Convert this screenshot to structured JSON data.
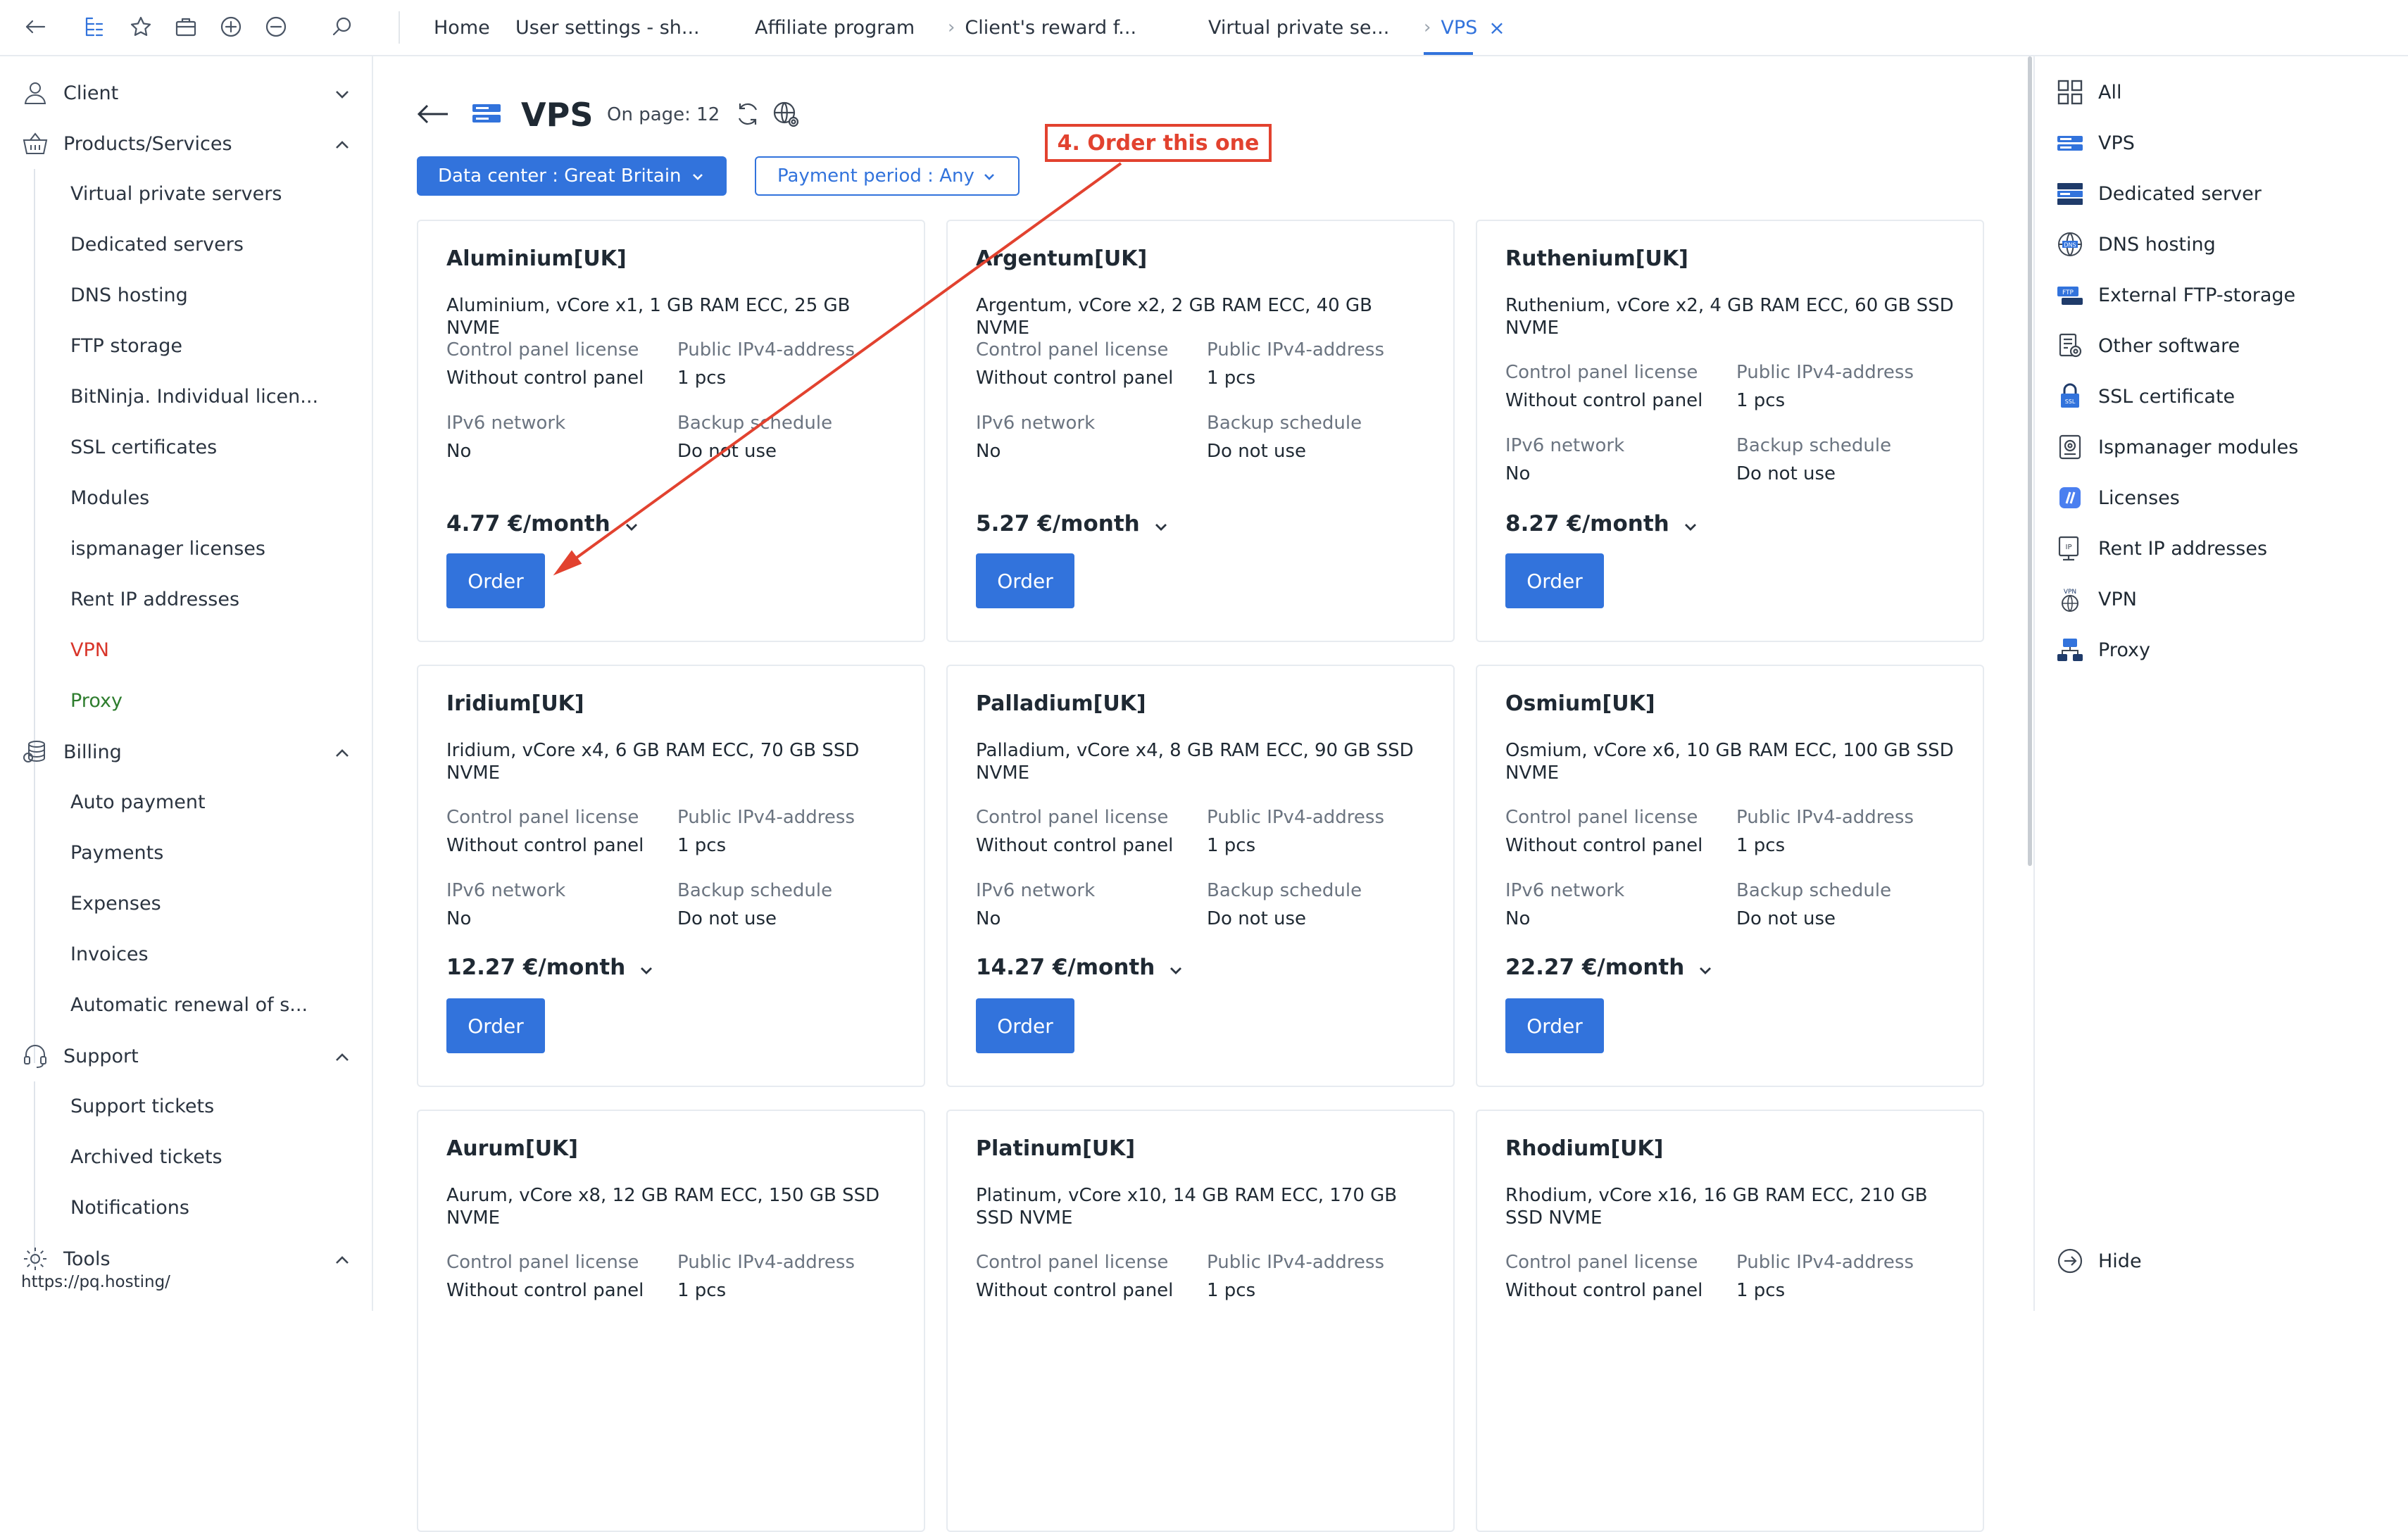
{
  "topbar": {
    "tabs": [
      {
        "label": "Home"
      },
      {
        "label": "User settings - sh..."
      },
      {
        "label": "Affiliate program"
      },
      {
        "label": "Client's reward f..."
      },
      {
        "label": "Virtual private se..."
      },
      {
        "label": "VPS"
      }
    ],
    "close_glyph": "×"
  },
  "sidebar": {
    "sections": [
      {
        "label": "Client",
        "icon": "user-icon"
      },
      {
        "label": "Products/Services",
        "icon": "basket-icon"
      },
      {
        "label": "Billing",
        "icon": "coins-icon"
      },
      {
        "label": "Support",
        "icon": "headset-icon"
      },
      {
        "label": "Tools",
        "icon": "gear-icon"
      }
    ],
    "products": [
      "Virtual private servers",
      "Dedicated servers",
      "DNS hosting",
      "FTP storage",
      "BitNinja. Individual licen...",
      "SSL certificates",
      "Modules",
      "ispmanager licenses",
      "Rent IP addresses",
      "VPN",
      "Proxy"
    ],
    "billing": [
      "Auto payment",
      "Payments",
      "Expenses",
      "Invoices",
      "Automatic renewal of s..."
    ],
    "support": [
      "Support tickets",
      "Archived tickets",
      "Notifications"
    ],
    "status_url": "https://pq.hosting/"
  },
  "main": {
    "title": "VPS",
    "on_page": "On page: 12",
    "filters": {
      "datacenter": "Data center : Great Britain",
      "period": "Payment period : Any"
    },
    "field_labels": {
      "cp": "Control panel license",
      "ip": "Public IPv4-address",
      "ipv6": "IPv6 network",
      "backup": "Backup schedule"
    },
    "order_label": "Order",
    "cards": [
      {
        "name": "Aluminium[UK]",
        "desc": "Aluminium, vCore x1, 1 GB RAM ECC, 25 GB NVME",
        "cp": "Without control panel",
        "ip": "1 pcs",
        "ipv6": "No",
        "backup": "Do not use",
        "price": "4.77 €/month"
      },
      {
        "name": "Argentum[UK]",
        "desc": "Argentum, vCore x2, 2 GB RAM ECC, 40 GB NVME",
        "cp": "Without control panel",
        "ip": "1 pcs",
        "ipv6": "No",
        "backup": "Do not use",
        "price": "5.27 €/month"
      },
      {
        "name": "Ruthenium[UK]",
        "desc": "Ruthenium, vCore x2, 4 GB RAM ECC, 60 GB SSD NVME",
        "cp": "Without control panel",
        "ip": "1 pcs",
        "ipv6": "No",
        "backup": "Do not use",
        "price": "8.27 €/month"
      },
      {
        "name": "Iridium[UK]",
        "desc": "Iridium, vCore x4, 6 GB RAM ECC, 70 GB SSD NVME",
        "cp": "Without control panel",
        "ip": "1 pcs",
        "ipv6": "No",
        "backup": "Do not use",
        "price": "12.27 €/month"
      },
      {
        "name": "Palladium[UK]",
        "desc": "Palladium, vCore x4, 8 GB RAM ECC, 90 GB SSD NVME",
        "cp": "Without control panel",
        "ip": "1 pcs",
        "ipv6": "No",
        "backup": "Do not use",
        "price": "14.27 €/month"
      },
      {
        "name": "Osmium[UK]",
        "desc": "Osmium, vCore x6, 10 GB RAM ECC, 100 GB SSD NVME",
        "cp": "Without control panel",
        "ip": "1 pcs",
        "ipv6": "No",
        "backup": "Do not use",
        "price": "22.27 €/month"
      },
      {
        "name": "Aurum[UK]",
        "desc": "Aurum, vCore x8, 12 GB RAM ECC, 150 GB SSD NVME",
        "cp": "Without control panel",
        "ip": "1 pcs"
      },
      {
        "name": "Platinum[UK]",
        "desc": "Platinum, vCore x10, 14 GB RAM ECC, 170 GB SSD NVME",
        "cp": "Without control panel",
        "ip": "1 pcs"
      },
      {
        "name": "Rhodium[UK]",
        "desc": "Rhodium, vCore x16, 16 GB RAM ECC, 210 GB SSD NVME",
        "cp": "Without control panel",
        "ip": "1 pcs"
      }
    ]
  },
  "right_panel": {
    "items": [
      {
        "label": "All",
        "icon": "grid-icon"
      },
      {
        "label": "VPS",
        "icon": "vps-icon"
      },
      {
        "label": "Dedicated server",
        "icon": "server-icon"
      },
      {
        "label": "DNS hosting",
        "icon": "dns-icon"
      },
      {
        "label": "External FTP-storage",
        "icon": "ftp-icon"
      },
      {
        "label": "Other software",
        "icon": "software-icon"
      },
      {
        "label": "SSL certificate",
        "icon": "ssl-icon"
      },
      {
        "label": "Ispmanager modules",
        "icon": "module-icon"
      },
      {
        "label": "Licenses",
        "icon": "license-icon"
      },
      {
        "label": "Rent IP addresses",
        "icon": "ip-icon"
      },
      {
        "label": "VPN",
        "icon": "vpn-icon"
      },
      {
        "label": "Proxy",
        "icon": "proxy-icon"
      }
    ],
    "hide_label": "Hide"
  },
  "annotation": {
    "text": "4. Order this one",
    "color": "#e2422f"
  },
  "colors": {
    "accent": "#3273dc",
    "vpn": "#d8352a",
    "proxy": "#2e7d2e"
  }
}
